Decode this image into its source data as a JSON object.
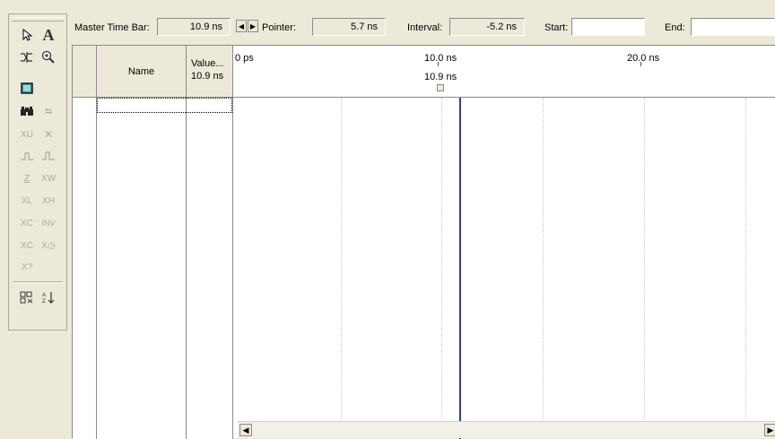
{
  "topbar": {
    "master_label": "Master Time Bar:",
    "master_value": "10.9 ns",
    "pointer_label": "Pointer:",
    "pointer_value": "5.7 ns",
    "interval_label": "Interval:",
    "interval_value": "-5.2 ns",
    "start_label": "Start:",
    "start_value": "",
    "end_label": "End:",
    "end_value": ""
  },
  "table": {
    "name_header": "Name",
    "value_header": "Value...",
    "value_subheader": "10.9 ns"
  },
  "timeline": {
    "ticks": [
      "0 ps",
      "10.0 ns",
      "20.0 ns"
    ],
    "master_marker": "10.9 ns"
  },
  "toolbar": {
    "icons": [
      "selection-tool-icon",
      "text-tool-icon",
      "waveform-editing-icon",
      "zoom-tool-icon",
      "full-screen-icon",
      "find-icon",
      "replace-icon",
      "uninitialized-icon",
      "forcing-unknown-icon",
      "forcing-low-icon",
      "forcing-high-icon",
      "high-impedance-icon",
      "weak-unknown-icon",
      "weak-low-icon",
      "weak-high-icon",
      "invert-icon",
      "count-value-icon",
      "clock-icon",
      "random-values-icon",
      "insert-node-icon",
      "sort-icon"
    ]
  }
}
